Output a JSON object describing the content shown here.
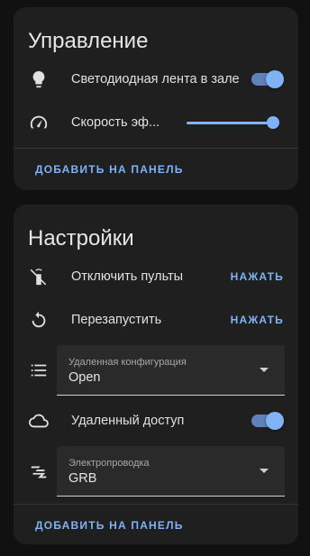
{
  "control_card": {
    "title": "Управление",
    "rows": [
      {
        "icon": "lightbulb-icon",
        "label": "Светодиодная лента в зале",
        "toggle_on": true
      },
      {
        "icon": "speedometer-icon",
        "label": "Скорость эф...",
        "slider_value": 1.0
      }
    ],
    "action": "ДОБАВИТЬ НА ПАНЕЛЬ"
  },
  "settings_card": {
    "title": "Настройки",
    "rows": [
      {
        "icon": "remote-off-icon",
        "label": "Отключить пульты",
        "button": "НАЖАТЬ"
      },
      {
        "icon": "restart-icon",
        "label": "Перезапустить",
        "button": "НАЖАТЬ"
      },
      {
        "icon": "list-icon",
        "select_label": "Удаленная конфигурация",
        "select_value": "Open"
      },
      {
        "icon": "cloud-icon",
        "label": "Удаленный доступ",
        "toggle_on": true
      },
      {
        "icon": "led-strip-icon",
        "select_label": "Электропроводка",
        "select_value": "GRB"
      }
    ],
    "action": "ДОБАВИТЬ НА ПАНЕЛЬ"
  },
  "colors": {
    "accent": "#7fb3f6",
    "card": "#1f1f1f",
    "background": "#111111"
  }
}
